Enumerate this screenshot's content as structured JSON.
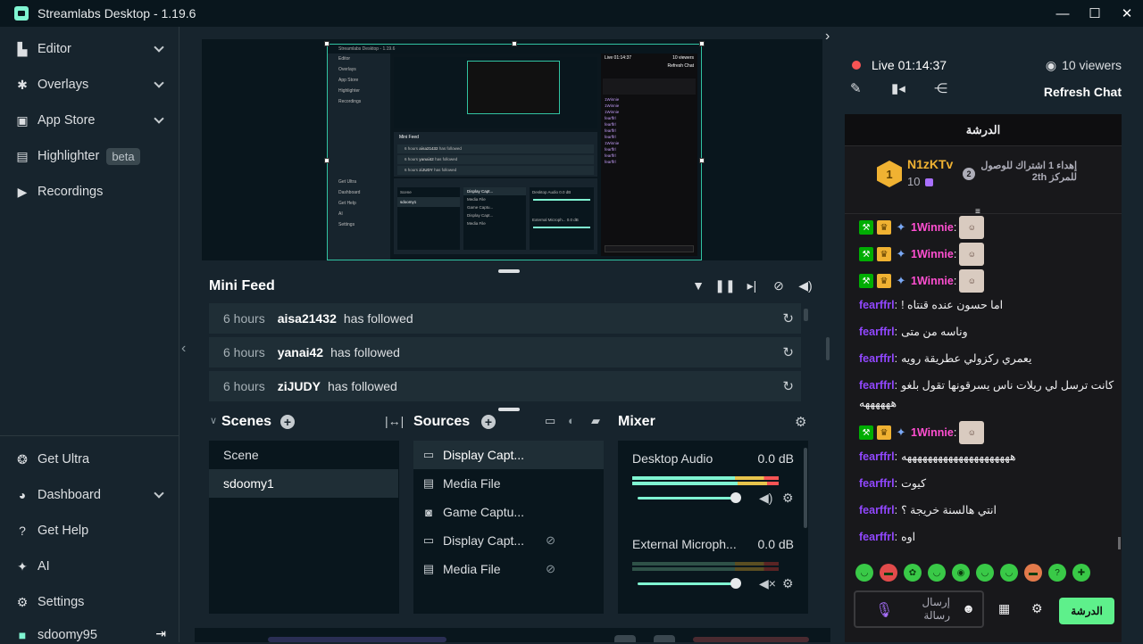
{
  "window": {
    "title": "Streamlabs Desktop - 1.19.6",
    "controls": [
      "—",
      "☐",
      "✕"
    ]
  },
  "sidebar": {
    "items": [
      {
        "label": "Editor",
        "icon": "editor-icon",
        "chevron": true
      },
      {
        "label": "Overlays",
        "icon": "overlays-icon",
        "chevron": true
      },
      {
        "label": "App Store",
        "icon": "app-store-icon",
        "chevron": true
      },
      {
        "label": "Highlighter",
        "icon": "highlighter-icon",
        "badge": "beta"
      },
      {
        "label": "Recordings",
        "icon": "recordings-icon"
      }
    ],
    "bottom_items": [
      {
        "label": "Get Ultra",
        "icon": "ultra-icon"
      },
      {
        "label": "Dashboard",
        "icon": "dashboard-icon",
        "chevron": true
      },
      {
        "label": "Get Help",
        "icon": "help-icon"
      },
      {
        "label": "AI",
        "icon": "ai-icon"
      },
      {
        "label": "Settings",
        "icon": "settings-icon"
      }
    ],
    "account": "sdoomy95"
  },
  "preview_thumbnail": {
    "title": "Streamlabs Desktop - 1.19.6",
    "live_time": "Live 01:14:37",
    "viewers": "10 viewers",
    "refresh": "Refresh Chat",
    "side_items": [
      "Editor",
      "Overlays",
      "App Store",
      "Highlighter",
      "Recordings",
      "Get Ultra",
      "Dashboard",
      "Get Help",
      "AI",
      "Settings"
    ],
    "minifeed_title": "Mini Feed",
    "feed": [
      {
        "time": "6 hours",
        "user": "aisa21432",
        "action": "has followed"
      },
      {
        "time": "6 hours",
        "user": "yanai42",
        "action": "has followed"
      },
      {
        "time": "6 hours",
        "user": "ziJUDY",
        "action": "has followed"
      }
    ],
    "scenes": [
      "Scene",
      "sdoomy1"
    ],
    "sources": [
      "Display Capt...",
      "Media File",
      "Game Captu...",
      "Display Capt...",
      "Media File"
    ],
    "mixer": [
      {
        "name": "Desktop Audio",
        "db": "0.0 dB"
      },
      {
        "name": "External Microph...",
        "db": "0.0 dB"
      }
    ]
  },
  "mini_feed": {
    "title": "Mini Feed",
    "tools": [
      "filter-icon",
      "pause-icon",
      "skip-icon",
      "mute-alerts-icon",
      "volume-icon"
    ],
    "rows": [
      {
        "time": "6 hours",
        "user": "aisa21432",
        "action": "has followed"
      },
      {
        "time": "6 hours",
        "user": "yanai42",
        "action": "has followed"
      },
      {
        "time": "6 hours",
        "user": "ziJUDY",
        "action": "has followed"
      }
    ]
  },
  "scenes": {
    "title": "Scenes",
    "items": [
      "Scene",
      "sdoomy1"
    ],
    "selected": "sdoomy1"
  },
  "sources": {
    "title": "Sources",
    "items": [
      {
        "label": "Display Capt...",
        "icon": "monitor-icon",
        "selected": true
      },
      {
        "label": "Media File",
        "icon": "file-icon"
      },
      {
        "label": "Game Captu...",
        "icon": "gamepad-icon"
      },
      {
        "label": "Display Capt...",
        "icon": "monitor-icon",
        "hidden": true
      },
      {
        "label": "Media File",
        "icon": "file-icon",
        "hidden": true
      }
    ]
  },
  "mixer": {
    "title": "Mixer",
    "channels": [
      {
        "name": "Desktop Audio",
        "db": "0.0 dB",
        "muted": false
      },
      {
        "name": "External Microph...",
        "db": "0.0 dB",
        "muted": true
      }
    ]
  },
  "stream": {
    "live_label": "Live",
    "live_time": "01:14:37",
    "viewers": "10 viewers",
    "refresh_chat": "Refresh Chat"
  },
  "chat": {
    "header": "الدرشة",
    "hype": {
      "rank1": "1",
      "user": "N1zKTv",
      "count": "10",
      "rank2": "2",
      "text": "إهداء 1 اشتراك للوصول للمركز 2th"
    },
    "messages": [
      {
        "user": "1Winnie",
        "badges": true,
        "emote": true,
        "text": ""
      },
      {
        "user": "1Winnie",
        "badges": true,
        "emote": true,
        "text": ""
      },
      {
        "user": "1Winnie",
        "badges": true,
        "emote": true,
        "text": ""
      },
      {
        "user": "fearffrl",
        "text": "اما حسون عنده قنتاه !"
      },
      {
        "user": "fearffrl",
        "text": "وناسه من متى"
      },
      {
        "user": "fearffrl",
        "text": "يعمري ركزولي عطريقة رويه"
      },
      {
        "user": "fearffrl",
        "text": "كانت ترسل لي ريلات ناس يسرقونها تقول بلغو",
        "text2": "ههههههه"
      },
      {
        "user": "1Winnie",
        "badges": true,
        "emote": true,
        "text": ""
      },
      {
        "user": "fearffrl",
        "text": "هههههههههههههههههههههه"
      },
      {
        "user": "fearffrl",
        "text": "كيوت"
      },
      {
        "user": "fearffrl",
        "text": "انتي هالسنة خريجة ؟"
      },
      {
        "user": "fearffrl",
        "text": "اوه"
      }
    ],
    "emotes": [
      "halo-emote",
      "angry-emote",
      "clown-emote",
      "smile-emote",
      "eye-emote",
      "grin-emote",
      "wave-emote",
      "sunglasses-emote",
      "think-emote",
      "sick-emote"
    ],
    "input_placeholder": "إرسال رسالة",
    "send_label": "الدرشة"
  },
  "colors": {
    "accent": "#80f5d2",
    "live": "#f85454",
    "twitch_purple": "#9147ff",
    "vip_gold": "#f0b232",
    "send_green": "#5ef08b"
  }
}
